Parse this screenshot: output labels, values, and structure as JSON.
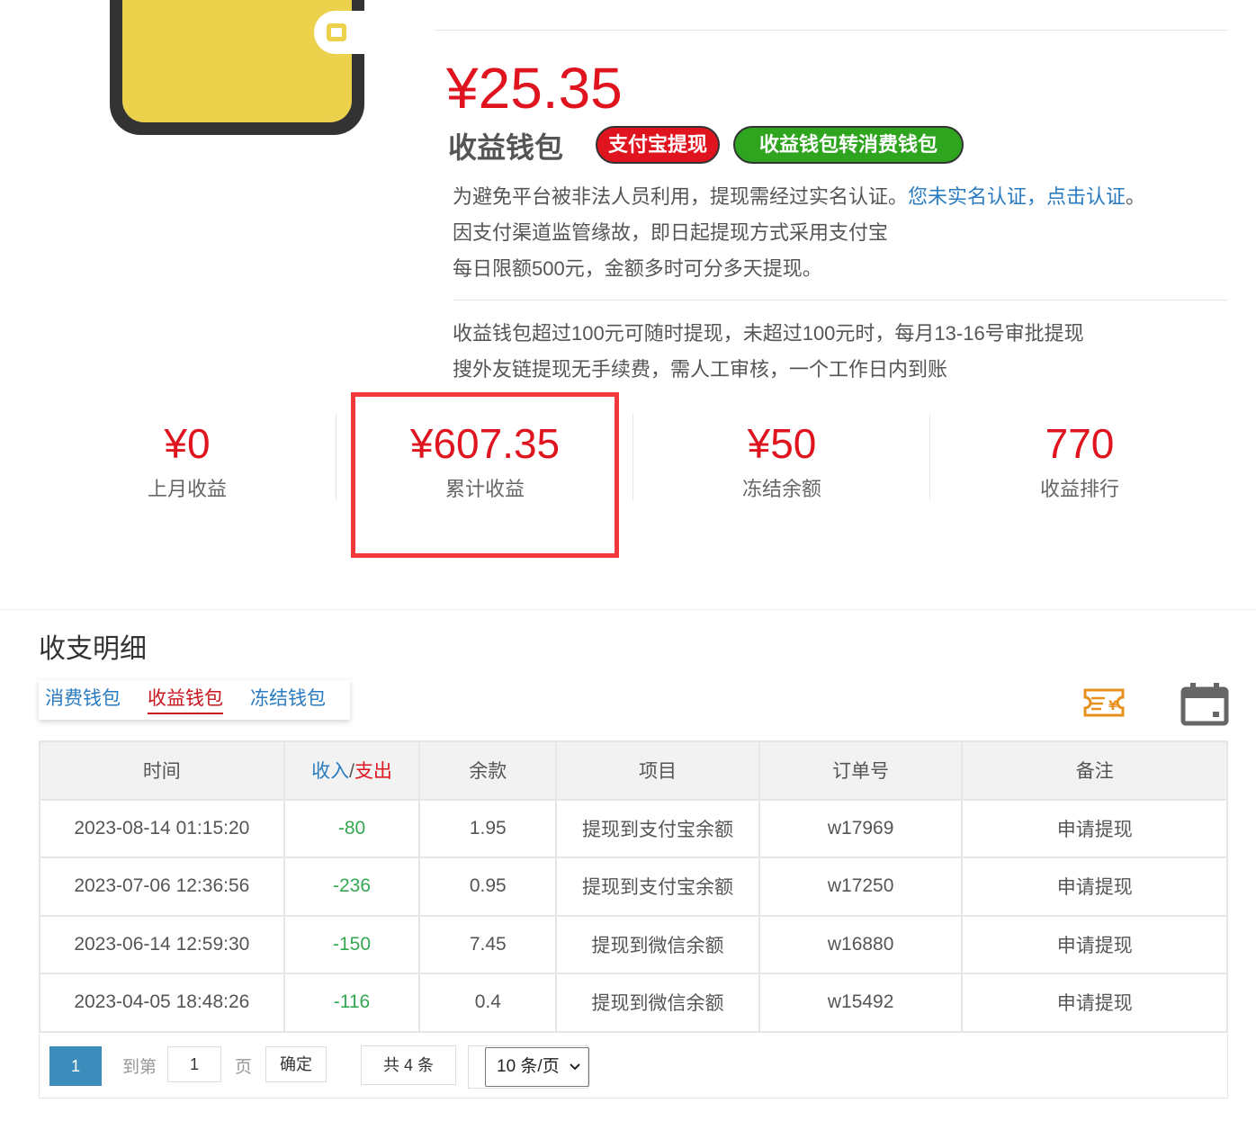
{
  "wallet": {
    "balance": "¥25.35",
    "title": "收益钱包",
    "alipay_withdraw_label": "支付宝提现",
    "transfer_label": "收益钱包转消费钱包"
  },
  "notice": {
    "line1_text": "为避免平台被非法人员利用，提现需经过实名认证。",
    "line1_link1": "您未实名认证，",
    "line1_link2": "点击认证",
    "line1_end": "。",
    "line2": "因支付渠道监管缘故，即日起提现方式采用支付宝",
    "line3": "每日限额500元，金额多时可分多天提现。",
    "line4": "收益钱包超过100元可随时提现，未超过100元时，每月13-16号审批提现",
    "line5": "搜外友链提现无手续费，需人工审核，一个工作日内到账"
  },
  "stats": [
    {
      "value": "¥0",
      "label": "上月收益"
    },
    {
      "value": "¥607.35",
      "label": "累计收益"
    },
    {
      "value": "¥50",
      "label": "冻结余额"
    },
    {
      "value": "770",
      "label": "收益排行"
    }
  ],
  "ledger": {
    "title": "收支明细",
    "tabs": [
      {
        "label": "消费钱包"
      },
      {
        "label": "收益钱包"
      },
      {
        "label": "冻结钱包"
      }
    ],
    "headers": {
      "time": "时间",
      "in": "收入",
      "slash": "/",
      "out": "支出",
      "balance": "余款",
      "item": "项目",
      "order": "订单号",
      "note": "备注"
    },
    "rows": [
      {
        "time": "2023-08-14 01:15:20",
        "amount": "-80",
        "balance": "1.95",
        "item": "提现到支付宝余额",
        "order": "w17969",
        "note": "申请提现"
      },
      {
        "time": "2023-07-06 12:36:56",
        "amount": "-236",
        "balance": "0.95",
        "item": "提现到支付宝余额",
        "order": "w17250",
        "note": "申请提现"
      },
      {
        "time": "2023-06-14 12:59:30",
        "amount": "-150",
        "balance": "7.45",
        "item": "提现到微信余额",
        "order": "w16880",
        "note": "申请提现"
      },
      {
        "time": "2023-04-05 18:48:26",
        "amount": "-116",
        "balance": "0.4",
        "item": "提现到微信余额",
        "order": "w15492",
        "note": "申请提现"
      }
    ]
  },
  "pager": {
    "current": "1",
    "goto_label": "到第",
    "goto_value": "1",
    "page_unit": "页",
    "confirm_label": "确定",
    "total_label": "共 4 条",
    "page_size": "10 条/页"
  },
  "icons": {
    "voucher": "voucher-yen-icon",
    "calendar": "calendar-icon"
  },
  "colors": {
    "accent_red": "#e0141e",
    "brand_green": "#2fa51f",
    "link_blue": "#2b7bc0",
    "pager_blue": "#3c8dbc",
    "wallet_yellow": "#ecd14d"
  }
}
